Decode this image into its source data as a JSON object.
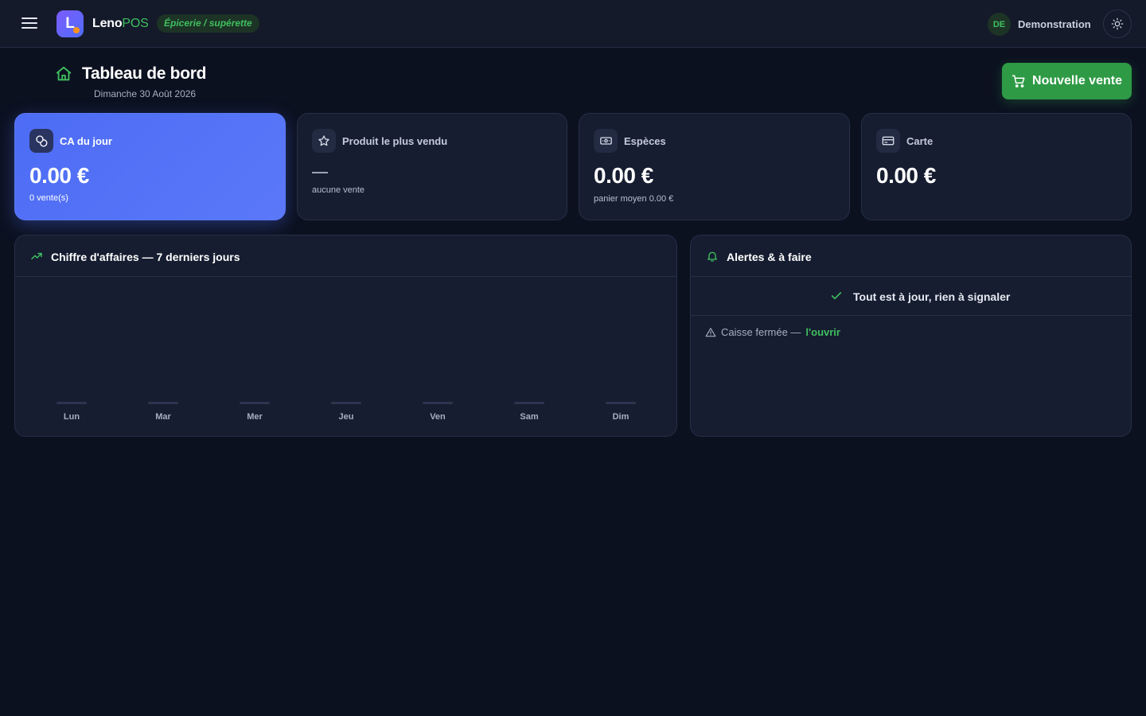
{
  "app": {
    "brand_part1": "Leno",
    "brand_part2": "POS",
    "logo_letter": "L",
    "store_type": "Épicerie / supérette",
    "accent": "#3fbf5f",
    "primary": "#4d6cf5"
  },
  "user": {
    "initials": "DE",
    "name": "Demonstration"
  },
  "header": {
    "title": "Tableau de bord",
    "date": "Dimanche 30 Août 2026",
    "new_sale_label": "Nouvelle vente"
  },
  "kpis": {
    "revenue": {
      "label": "CA du jour",
      "value": "0.00 €",
      "sub": "0 vente(s)"
    },
    "top_product": {
      "label": "Produit le plus vendu",
      "value": "—",
      "sub": "aucune vente"
    },
    "cash": {
      "label": "Espèces",
      "value": "0.00 €",
      "sub": "panier moyen 0.00 €"
    },
    "card": {
      "label": "Carte",
      "value": "0.00 €"
    }
  },
  "revenue_panel": {
    "title": "Chiffre d'affaires — 7 derniers jours"
  },
  "chart_data": {
    "type": "bar",
    "categories": [
      "Lun",
      "Mar",
      "Mer",
      "Jeu",
      "Ven",
      "Sam",
      "Dim"
    ],
    "values": [
      0,
      0,
      0,
      0,
      0,
      0,
      0
    ],
    "title": "",
    "xlabel": "",
    "ylabel": "",
    "grid": false
  },
  "alerts_panel": {
    "title": "Alertes & à faire",
    "all_good": "Tout est à jour, rien à signaler",
    "alert_text": "Caisse fermée —",
    "alert_link": "l'ouvrir"
  }
}
